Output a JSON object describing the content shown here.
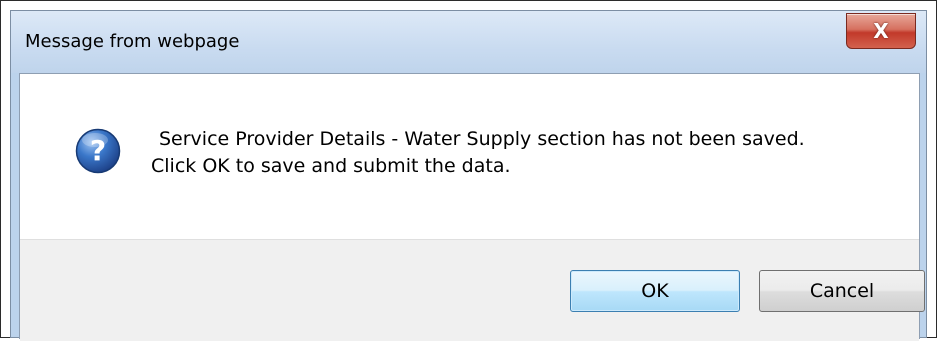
{
  "dialog": {
    "title": "Message from webpage",
    "close_label": "X",
    "icon": "question-icon",
    "message_line1": "Service Provider Details - Water Supply section has not been saved.",
    "message_line2": "Click OK to save and submit the data.",
    "ok_label": "OK",
    "cancel_label": "Cancel"
  }
}
